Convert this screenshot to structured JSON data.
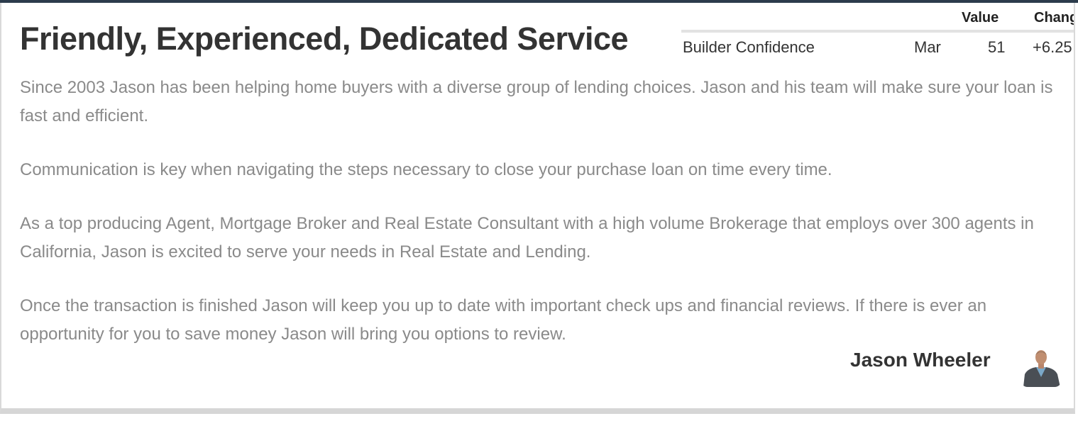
{
  "heading": "Friendly, Experienced, Dedicated Service",
  "ticker": {
    "headers": {
      "value": "Value",
      "change": "Chang"
    },
    "row": {
      "name": "Builder Confidence",
      "month": "Mar",
      "value": "51",
      "change": "+6.25"
    }
  },
  "bio": {
    "p1": "Since 2003 Jason has been helping home buyers with a diverse group of lending choices. Jason and his team will make sure your loan is fast and efficient.",
    "p2": "Communication is key when navigating the steps necessary to close your purchase loan on time every time.",
    "p3": "As a top producing Agent, Mortgage Broker and Real Estate Consultant with a high volume Brokerage that employs over 300 agents in California, Jason is excited to serve your needs in Real Estate and Lending.",
    "p4": "Once the transaction is finished Jason will keep you up to date with important check ups and financial reviews. If there is ever an opportunity for you to save money Jason will bring you options to review."
  },
  "signature": {
    "name": "Jason Wheeler",
    "avatar_icon": "person-photo-icon"
  },
  "colors": {
    "top_bar": "#2c3c4c",
    "heading": "#333333",
    "body_text": "#8a8a8a"
  }
}
